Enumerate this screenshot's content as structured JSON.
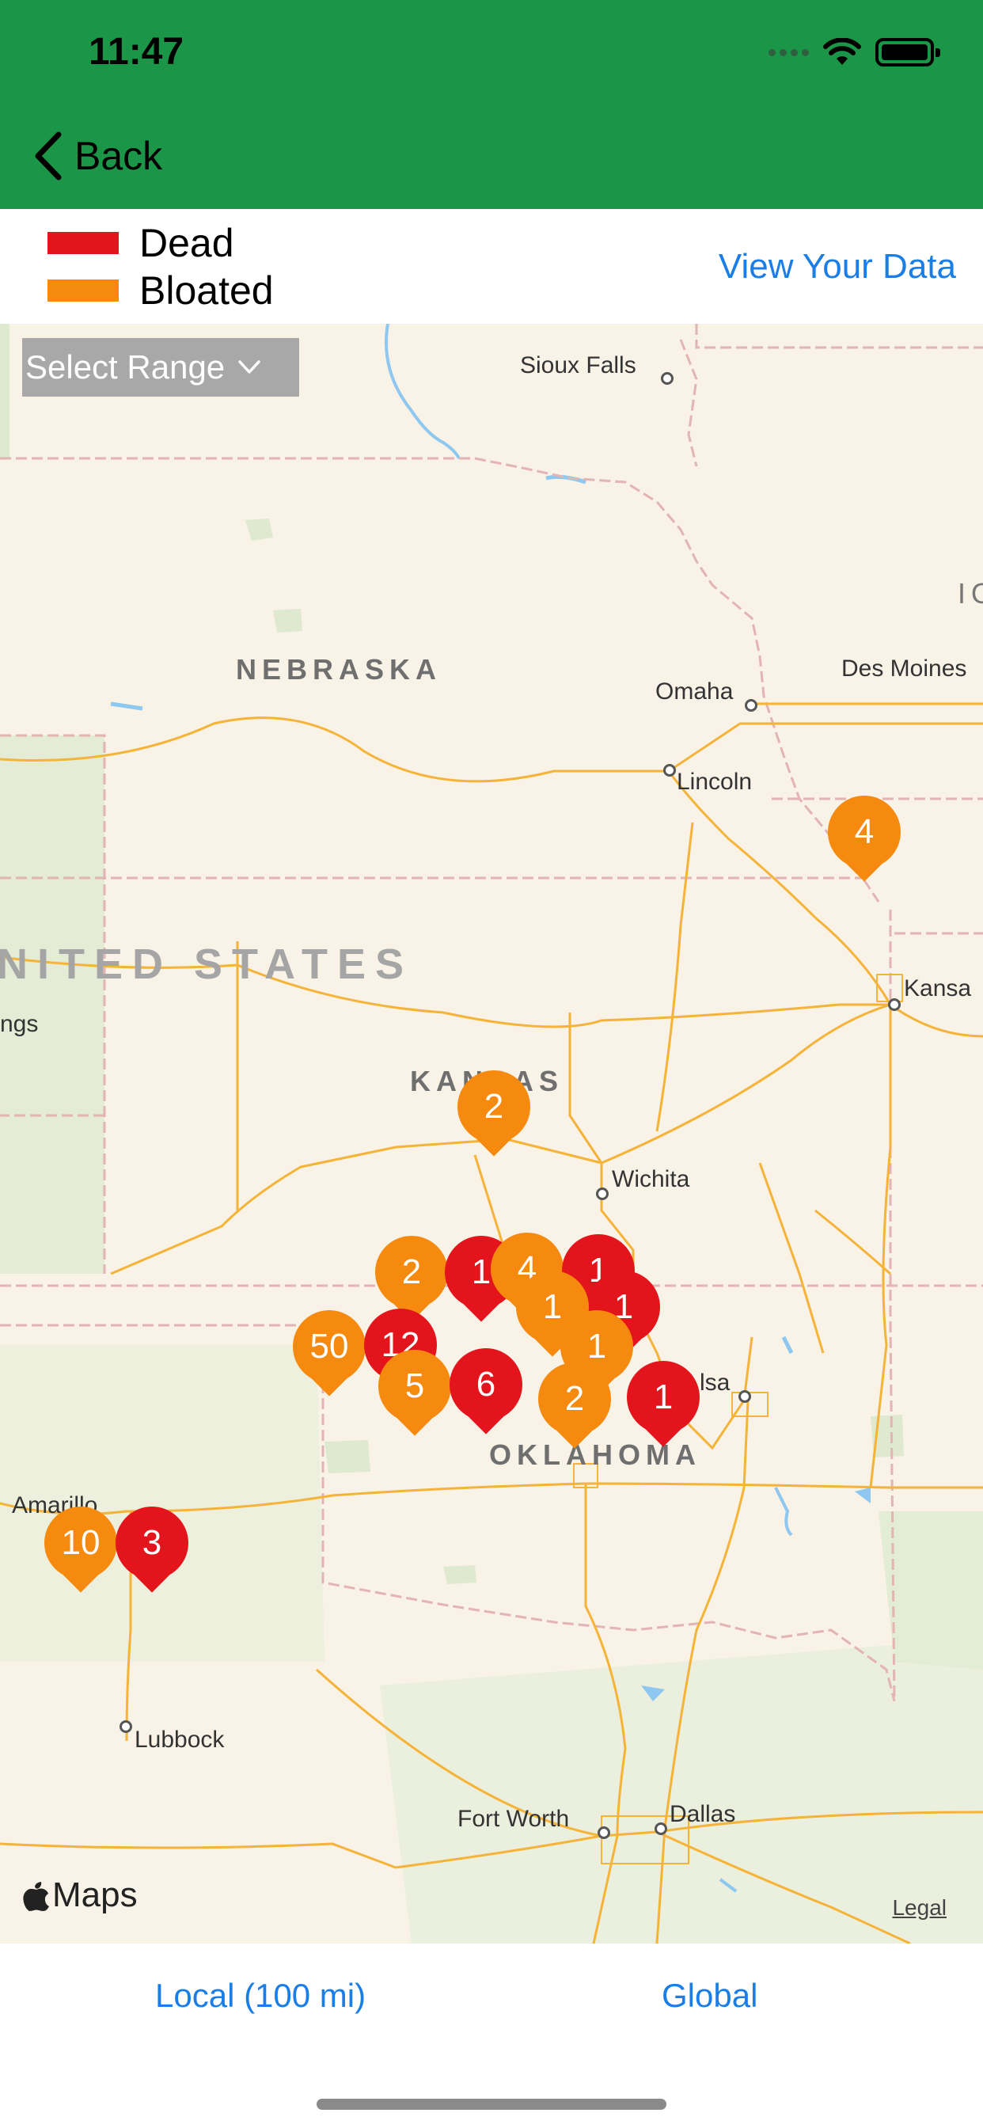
{
  "status_bar": {
    "time": "11:47",
    "wifi_icon": "wifi-icon",
    "battery_icon": "battery-icon"
  },
  "nav": {
    "back_label": "Back",
    "back_icon": "chevron-left-icon"
  },
  "legend": {
    "items": [
      {
        "label": "Dead",
        "color": "#e3141c"
      },
      {
        "label": "Bloated",
        "color": "#f58a0f"
      }
    ],
    "view_data_link": "View Your Data"
  },
  "map": {
    "range_select": {
      "label": "Select Range",
      "icon": "chevron-down-icon"
    },
    "country_label": "NITED STATES",
    "state_labels": {
      "nebraska": "NEBRASKA",
      "kansas": "KANSAS",
      "oklahoma": "OKLAHOMA"
    },
    "city_labels": {
      "sioux_falls": "Sioux Falls",
      "omaha": "Omaha",
      "lincoln": "Lincoln",
      "des_moines": "Des Moines",
      "kansas_city": "Kansa",
      "wichita": "Wichita",
      "tulsa": "lsa",
      "amarillo": "Amarillo",
      "lubbock": "Lubbock",
      "fort_worth": "Fort Worth",
      "dallas": "Dallas",
      "springs": "ngs",
      "iowa_edge": "IO"
    },
    "pins": [
      {
        "count": "4",
        "type": "bloated"
      },
      {
        "count": "2",
        "type": "bloated"
      },
      {
        "count": "2",
        "type": "bloated"
      },
      {
        "count": "1",
        "type": "dead"
      },
      {
        "count": "4",
        "type": "bloated"
      },
      {
        "count": "1",
        "type": "dead"
      },
      {
        "count": "1",
        "type": "bloated"
      },
      {
        "count": "1",
        "type": "dead"
      },
      {
        "count": "1",
        "type": "bloated"
      },
      {
        "count": "50",
        "type": "bloated"
      },
      {
        "count": "12",
        "type": "dead"
      },
      {
        "count": "5",
        "type": "bloated"
      },
      {
        "count": "6",
        "type": "dead"
      },
      {
        "count": "2",
        "type": "bloated"
      },
      {
        "count": "1",
        "type": "dead"
      },
      {
        "count": "10",
        "type": "bloated"
      },
      {
        "count": "3",
        "type": "dead"
      }
    ],
    "attribution": "Maps",
    "apple_icon": "apple-logo-icon",
    "legal_link": "Legal"
  },
  "bottom_tabs": {
    "local": "Local (100 mi)",
    "global": "Global"
  }
}
